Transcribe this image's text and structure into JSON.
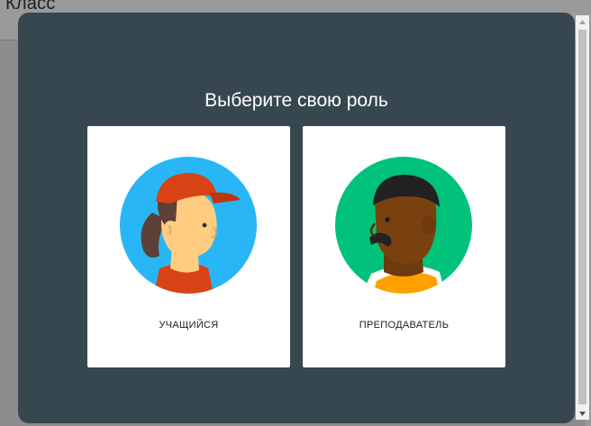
{
  "background_page": {
    "title": "Класс"
  },
  "dialog": {
    "title": "Выберите свою роль",
    "roles": [
      {
        "label": "УЧАЩИЙСЯ",
        "avatar_icon": "student-avatar-icon"
      },
      {
        "label": "ПРЕПОДАВАТЕЛЬ",
        "avatar_icon": "teacher-avatar-icon"
      }
    ]
  },
  "colors": {
    "dialog_bg": "#37474f",
    "card_bg": "#ffffff",
    "student_circle": "#29b6f6",
    "student_cap": "#d84315",
    "teacher_circle": "#00c27a",
    "teacher_shirt_accent": "#ffa000"
  }
}
